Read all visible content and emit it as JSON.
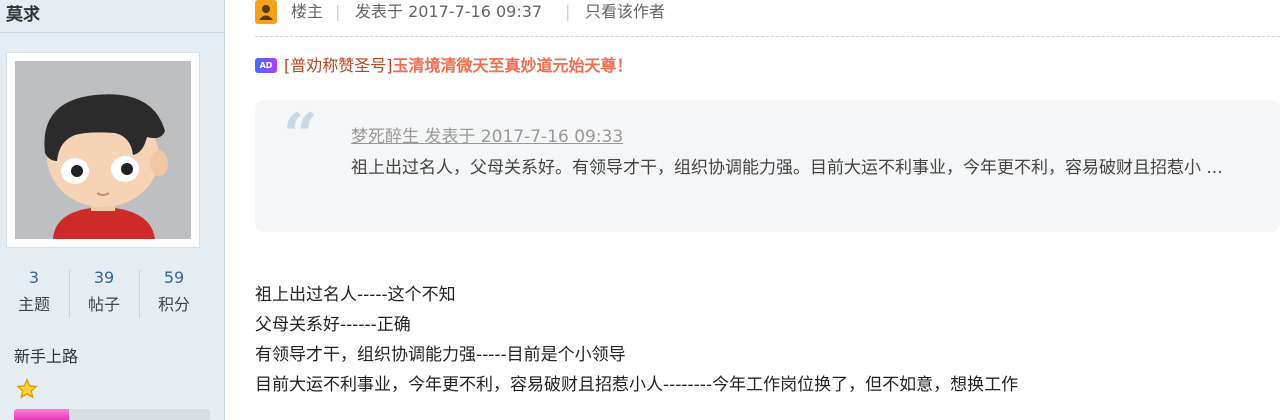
{
  "user": {
    "name": "莫求",
    "stats": [
      {
        "value": "3",
        "label": "主题"
      },
      {
        "value": "39",
        "label": "帖子"
      },
      {
        "value": "59",
        "label": "积分"
      }
    ],
    "group": "新手上路",
    "rank_icon": "star-icon",
    "progress": 0.28
  },
  "post": {
    "poster_label": "楼主",
    "posted_at": "发表于 2017-7-16 09:37",
    "author_only": "只看该作者",
    "ad": {
      "badge": "AD",
      "bracket_text": "[普劝称赞圣号]",
      "text": "玉清境清微天至真妙道元始天尊！"
    },
    "quote": {
      "author_line": "梦死醉生 发表于 2017-7-16 09:33",
      "body": "祖上出过名人，父母关系好。有领导才干，组织协调能力强。目前大运不利事业，今年更不利，容易破财且招惹小 ..."
    },
    "lines": [
      "祖上出过名人-----这个不知",
      "父母关系好------正确",
      "有领导才干，组织协调能力强-----目前是个小领导",
      "目前大运不利事业，今年更不利，容易破财且招惹小人--------今年工作岗位换了，但不如意，想换工作"
    ]
  },
  "colors": {
    "sidebar_bg": "#e5edf2",
    "ad_accent": "#f26c4f",
    "link_blue": "#336699"
  }
}
